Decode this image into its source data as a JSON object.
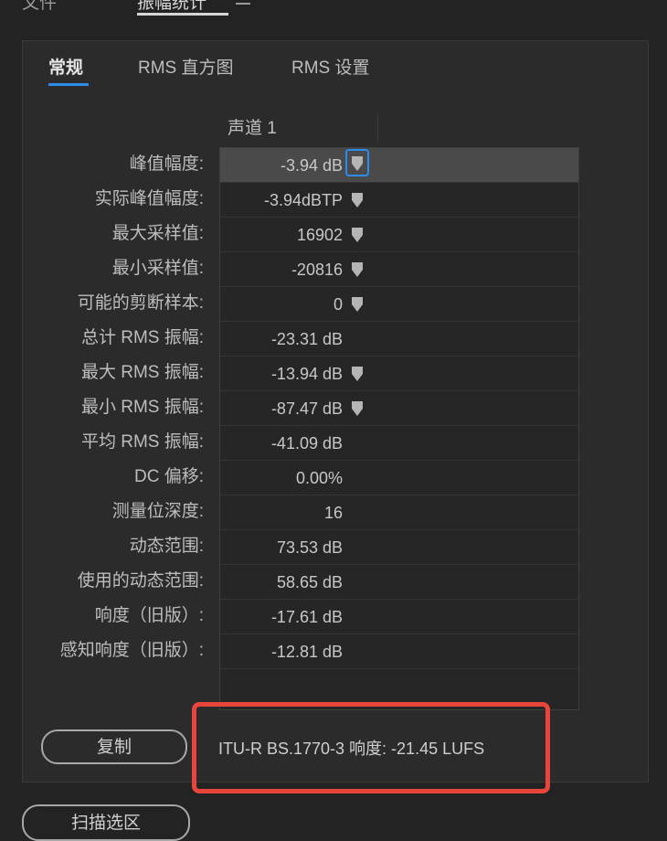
{
  "top_tabs": [
    {
      "label": "文件",
      "active": false
    },
    {
      "label": "振幅统计",
      "active": true
    }
  ],
  "panel_tabs": [
    {
      "label": "常规",
      "active": true
    },
    {
      "label": "RMS 直方图",
      "active": false
    },
    {
      "label": "RMS 设置",
      "active": false
    }
  ],
  "column_header": "声道 1",
  "rows": [
    {
      "label": "峰值幅度:",
      "value": "-3.94 dB",
      "marker": true,
      "selected": true
    },
    {
      "label": "实际峰值幅度:",
      "value": "-3.94dBTP",
      "marker": true,
      "selected": false
    },
    {
      "label": "最大采样值:",
      "value": "16902",
      "marker": true,
      "selected": false
    },
    {
      "label": "最小采样值:",
      "value": "-20816",
      "marker": true,
      "selected": false
    },
    {
      "label": "可能的剪断样本:",
      "value": "0",
      "marker": true,
      "selected": false
    },
    {
      "label": "总计 RMS 振幅:",
      "value": "-23.31 dB",
      "marker": false,
      "selected": false
    },
    {
      "label": "最大 RMS 振幅:",
      "value": "-13.94 dB",
      "marker": true,
      "selected": false
    },
    {
      "label": "最小 RMS 振幅:",
      "value": "-87.47 dB",
      "marker": true,
      "selected": false
    },
    {
      "label": "平均 RMS 振幅:",
      "value": "-41.09 dB",
      "marker": false,
      "selected": false
    },
    {
      "label": "DC 偏移:",
      "value": "0.00%",
      "marker": false,
      "selected": false
    },
    {
      "label": "测量位深度:",
      "value": "16",
      "marker": false,
      "selected": false
    },
    {
      "label": "动态范围:",
      "value": "73.53 dB",
      "marker": false,
      "selected": false
    },
    {
      "label": "使用的动态范围:",
      "value": "58.65 dB",
      "marker": false,
      "selected": false
    },
    {
      "label": "响度（旧版）:",
      "value": "-17.61 dB",
      "marker": false,
      "selected": false
    },
    {
      "label": "感知响度（旧版）:",
      "value": "-12.81 dB",
      "marker": false,
      "selected": false
    }
  ],
  "copy_button": "复制",
  "loudness_text": "ITU-R BS.1770-3 响度:  -21.45 LUFS",
  "scan_button": "扫描选区",
  "colors": {
    "accent": "#2d8ceb",
    "highlight": "#e8453c",
    "background": "#232323",
    "panel": "#2b2b2b"
  },
  "icons": {
    "row_marker": "marker-icon",
    "panel_menu": "hamburger-menu-icon"
  }
}
